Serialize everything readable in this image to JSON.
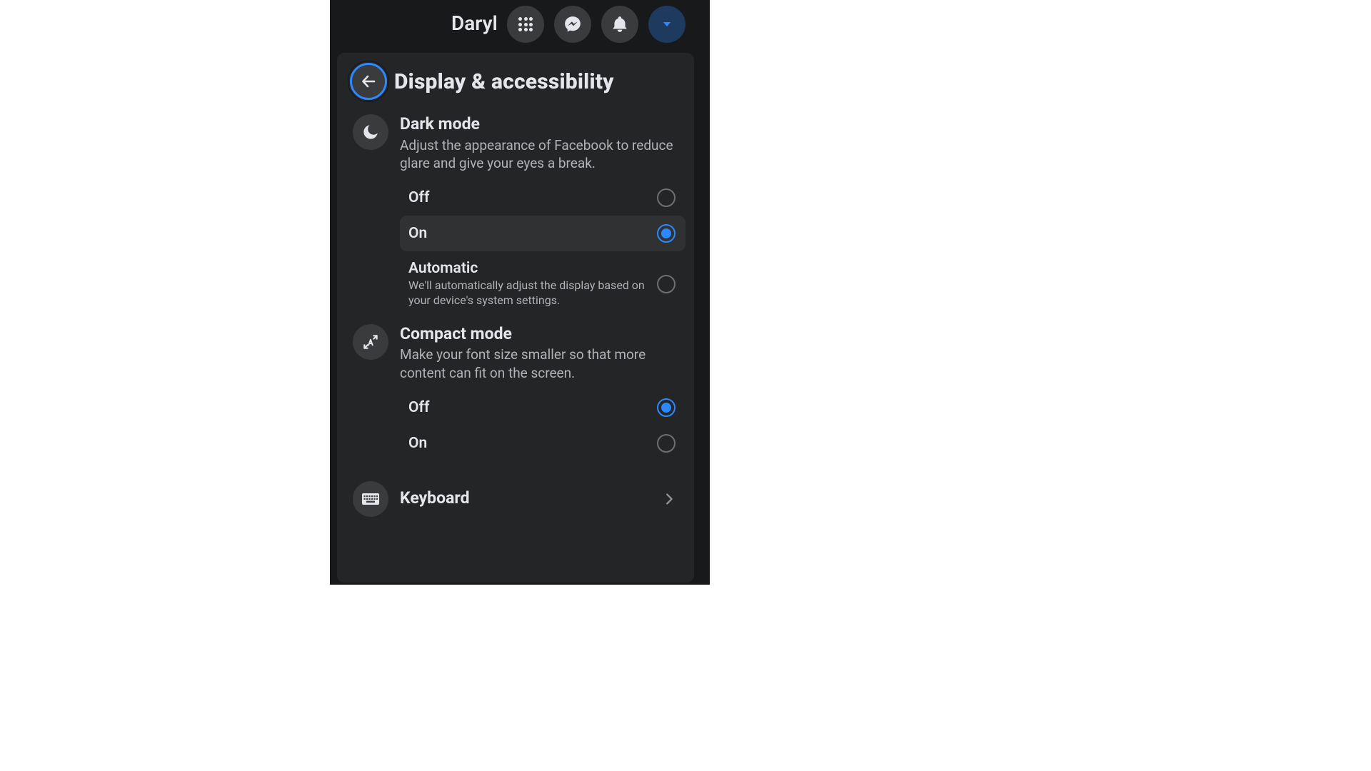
{
  "header": {
    "user_name": "Daryl"
  },
  "panel": {
    "title": "Display & accessibility",
    "back_icon": "arrow-left-icon"
  },
  "sections": [
    {
      "id": "dark_mode",
      "icon": "moon-icon",
      "title": "Dark mode",
      "description": "Adjust the appearance of Facebook to reduce glare and give your eyes a break.",
      "options": [
        {
          "label": "Off",
          "selected": false
        },
        {
          "label": "On",
          "selected": true
        },
        {
          "label": "Automatic",
          "description": "We'll automatically adjust the display based on your device's system settings.",
          "selected": false
        }
      ]
    },
    {
      "id": "compact_mode",
      "icon": "compact-icon",
      "title": "Compact mode",
      "description": "Make your font size smaller so that more content can fit on the screen.",
      "options": [
        {
          "label": "Off",
          "selected": true
        },
        {
          "label": "On",
          "selected": false
        }
      ]
    }
  ],
  "nav_item": {
    "id": "keyboard",
    "icon": "keyboard-icon",
    "title": "Keyboard"
  },
  "topbar_icons": [
    "menu-grid-icon",
    "messenger-icon",
    "bell-icon",
    "account-caret-icon"
  ],
  "colors": {
    "accent": "#2374e1",
    "accent_light": "#2d88ff",
    "panel": "#242526",
    "panel2": "#3a3b3c",
    "bg": "#18191a",
    "text": "#e4e6eb",
    "text_muted": "#b0b3b8"
  }
}
